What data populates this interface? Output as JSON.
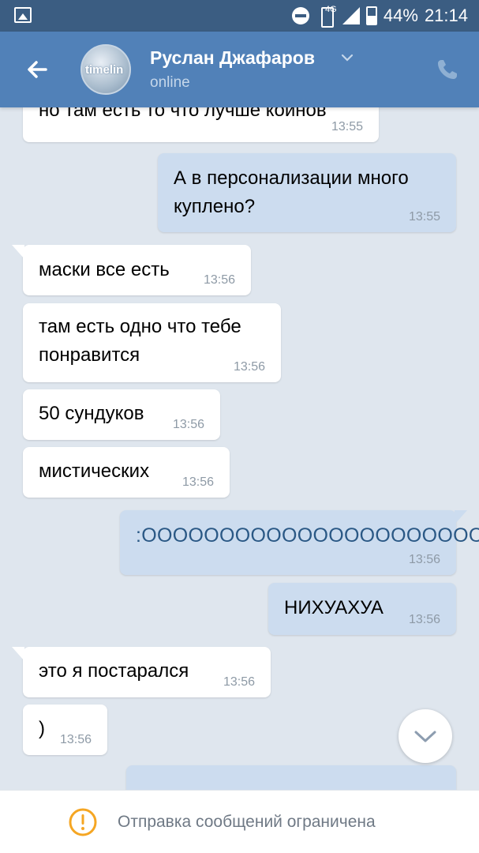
{
  "status_bar": {
    "network": "4G",
    "battery": "44%",
    "time": "21:14"
  },
  "header": {
    "contact_name": "Руслан Джафаров",
    "presence": "online",
    "avatar_text": "timelin"
  },
  "messages": [
    {
      "id": "m0",
      "dir": "in",
      "text": "но там есть то что лучше коинов",
      "time": "13:55"
    },
    {
      "id": "m1",
      "dir": "out",
      "text": "А в персонализации много куплено?",
      "time": "13:55"
    },
    {
      "id": "m2",
      "dir": "in",
      "text": "маски все есть",
      "time": "13:56"
    },
    {
      "id": "m3",
      "dir": "in",
      "text": "там есть одно что тебе понравится",
      "time": "13:56"
    },
    {
      "id": "m4",
      "dir": "in",
      "text": "50 сундуков",
      "time": "13:56"
    },
    {
      "id": "m5",
      "dir": "in",
      "text": "мистических",
      "time": "13:56"
    },
    {
      "id": "m6",
      "dir": "out",
      "text": ":OOOOOOOOOOOOOOOOOOOOOOOOO",
      "time": "13:56"
    },
    {
      "id": "m7",
      "dir": "out",
      "text": "НИХУАХУА",
      "time": "13:56"
    },
    {
      "id": "m8",
      "dir": "in",
      "text": "это я постарался",
      "time": "13:56"
    },
    {
      "id": "m9",
      "dir": "in",
      "text": ")",
      "time": "13:56"
    }
  ],
  "footer": {
    "notice": "Отправка сообщений ограничена",
    "icon": "warning-icon"
  },
  "colors": {
    "header": "#5181b8",
    "statusbar": "#3b5d82",
    "background": "#dfe6ee",
    "incoming": "#ffffff",
    "outgoing": "#ccdcef",
    "warning": "#f5a623"
  }
}
